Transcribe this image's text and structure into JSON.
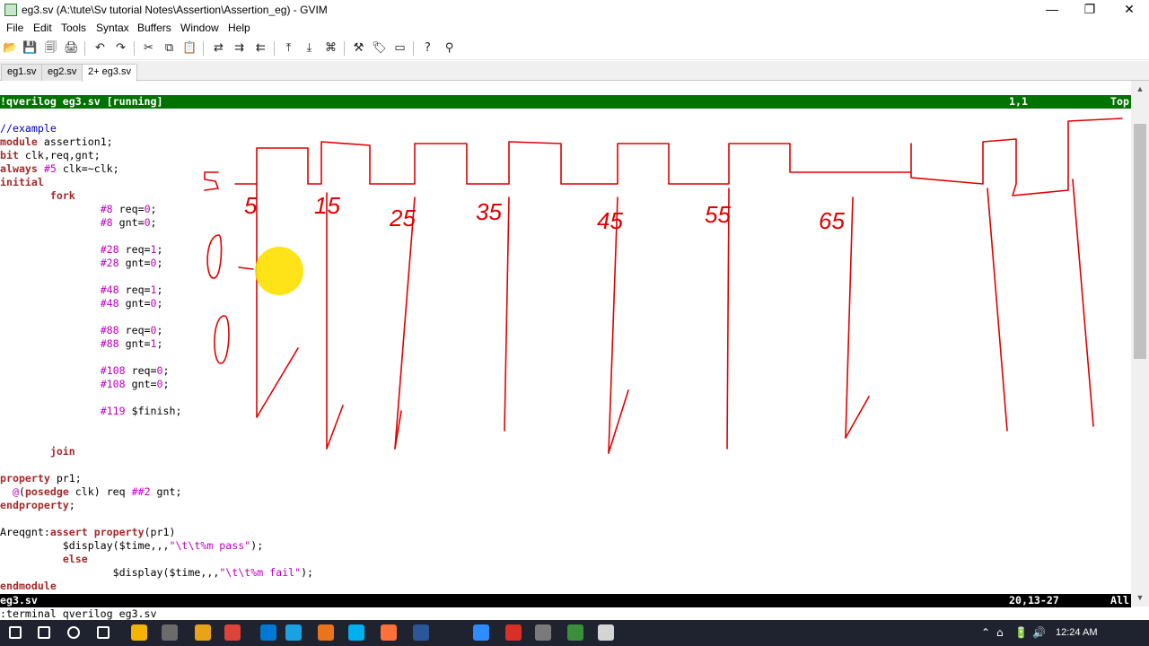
{
  "window": {
    "title": "eg3.sv (A:\\tute\\Sv tutorial Notes\\Assertion\\Assertion_eg) - GVIM",
    "minimize_glyph": "—",
    "maximize_glyph": "❐",
    "close_glyph": "✕"
  },
  "menu": [
    "File",
    "Edit",
    "Tools",
    "Syntax",
    "Buffers",
    "Window",
    "Help"
  ],
  "toolbar_icons": [
    "open-icon",
    "save-icon",
    "save-all-icon",
    "print-icon",
    "undo-icon",
    "redo-icon",
    "cut-icon",
    "copy-icon",
    "paste-icon",
    "replace-icon",
    "find-next-icon",
    "find-prev-icon",
    "load-session-icon",
    "save-session-icon",
    "run-script-icon",
    "make-icon",
    "build-tags-icon",
    "jump-tag-icon",
    "help-icon",
    "find-help-icon"
  ],
  "toolbar_glyphs": [
    "📂",
    "💾",
    "🗐",
    "🖨",
    "↶",
    "↷",
    "✂",
    "⧉",
    "📋",
    "⇄",
    "⇉",
    "⇇",
    "⤒",
    "⤓",
    "⌘",
    "⚒",
    "🏷",
    "▭",
    "?",
    "⚲"
  ],
  "tabs": [
    {
      "label": "eg1.sv",
      "active": false
    },
    {
      "label": "eg2.sv",
      "active": false
    },
    {
      "label": "2+ eg3.sv",
      "active": true
    }
  ],
  "top_status": {
    "left": "!qverilog eg3.sv [running]",
    "position": "1,1",
    "percent": "Top"
  },
  "bottom_status": {
    "left": "eg3.sv",
    "position": "20,13-27",
    "percent": "All"
  },
  "code_lines": [
    [
      {
        "t": "//example",
        "c": "cm"
      }
    ],
    [
      {
        "t": "module",
        "c": "kw"
      },
      {
        "t": " assertion1;"
      }
    ],
    [
      {
        "t": "bit",
        "c": "kw"
      },
      {
        "t": " clk,req,gnt;"
      }
    ],
    [
      {
        "t": "always",
        "c": "kw"
      },
      {
        "t": " "
      },
      {
        "t": "#5",
        "c": "num"
      },
      {
        "t": " clk=~clk;"
      }
    ],
    [
      {
        "t": "initial",
        "c": "kw"
      }
    ],
    [
      {
        "t": "        "
      },
      {
        "t": "fork",
        "c": "kw"
      }
    ],
    [
      {
        "t": "                "
      },
      {
        "t": "#8",
        "c": "num"
      },
      {
        "t": " req="
      },
      {
        "t": "0",
        "c": "num"
      },
      {
        "t": ";"
      }
    ],
    [
      {
        "t": "                "
      },
      {
        "t": "#8",
        "c": "num"
      },
      {
        "t": " gnt="
      },
      {
        "t": "0",
        "c": "num"
      },
      {
        "t": ";"
      }
    ],
    [
      {
        "t": ""
      }
    ],
    [
      {
        "t": "                "
      },
      {
        "t": "#28",
        "c": "num"
      },
      {
        "t": " req="
      },
      {
        "t": "1",
        "c": "num"
      },
      {
        "t": ";"
      }
    ],
    [
      {
        "t": "                "
      },
      {
        "t": "#28",
        "c": "num"
      },
      {
        "t": " gnt="
      },
      {
        "t": "0",
        "c": "num"
      },
      {
        "t": ";"
      }
    ],
    [
      {
        "t": ""
      }
    ],
    [
      {
        "t": "                "
      },
      {
        "t": "#48",
        "c": "num"
      },
      {
        "t": " req="
      },
      {
        "t": "1",
        "c": "num"
      },
      {
        "t": ";"
      }
    ],
    [
      {
        "t": "                "
      },
      {
        "t": "#48",
        "c": "num"
      },
      {
        "t": " gnt="
      },
      {
        "t": "0",
        "c": "num"
      },
      {
        "t": ";"
      }
    ],
    [
      {
        "t": ""
      }
    ],
    [
      {
        "t": "                "
      },
      {
        "t": "#88",
        "c": "num"
      },
      {
        "t": " req="
      },
      {
        "t": "0",
        "c": "num"
      },
      {
        "t": ";"
      }
    ],
    [
      {
        "t": "                "
      },
      {
        "t": "#88",
        "c": "num"
      },
      {
        "t": " gnt="
      },
      {
        "t": "1",
        "c": "num"
      },
      {
        "t": ";"
      }
    ],
    [
      {
        "t": ""
      }
    ],
    [
      {
        "t": "                "
      },
      {
        "t": "#108",
        "c": "num"
      },
      {
        "t": " req="
      },
      {
        "t": "0",
        "c": "num"
      },
      {
        "t": ";"
      }
    ],
    [
      {
        "t": "                "
      },
      {
        "t": "#108",
        "c": "num"
      },
      {
        "t": " gnt="
      },
      {
        "t": "0",
        "c": "num"
      },
      {
        "t": ";"
      }
    ],
    [
      {
        "t": ""
      }
    ],
    [
      {
        "t": "                "
      },
      {
        "t": "#119",
        "c": "num"
      },
      {
        "t": " $finish;"
      }
    ],
    [
      {
        "t": ""
      }
    ],
    [
      {
        "t": ""
      }
    ],
    [
      {
        "t": "        "
      },
      {
        "t": "join",
        "c": "kw"
      }
    ],
    [
      {
        "t": ""
      }
    ],
    [
      {
        "t": "property",
        "c": "kw"
      },
      {
        "t": " pr1;"
      }
    ],
    [
      {
        "t": "  "
      },
      {
        "t": "@",
        "c": "num"
      },
      {
        "t": "("
      },
      {
        "t": "posedge",
        "c": "kw"
      },
      {
        "t": " clk) req "
      },
      {
        "t": "##2",
        "c": "num"
      },
      {
        "t": " gnt;"
      }
    ],
    [
      {
        "t": "endproperty",
        "c": "kw"
      },
      {
        "t": ";"
      }
    ],
    [
      {
        "t": ""
      }
    ],
    [
      {
        "t": "Areqgnt:"
      },
      {
        "t": "assert",
        "c": "kw"
      },
      {
        "t": " "
      },
      {
        "t": "property",
        "c": "kw"
      },
      {
        "t": "(pr1)"
      }
    ],
    [
      {
        "t": "          $display($time,,,"
      },
      {
        "t": "\"\\t\\t%m pass\"",
        "c": "str"
      },
      {
        "t": ");"
      }
    ],
    [
      {
        "t": "          "
      },
      {
        "t": "else",
        "c": "kw"
      }
    ],
    [
      {
        "t": "                  $display($time,,,"
      },
      {
        "t": "\"\\t\\t%m fail\"",
        "c": "str"
      },
      {
        "t": ");"
      }
    ],
    [
      {
        "t": "endmodule",
        "c": "kw"
      }
    ]
  ],
  "command_line": ":terminal qverilog eg3.sv",
  "handwritten_labels": [
    "5",
    "5",
    "15",
    "25",
    "35",
    "45",
    "55",
    "65"
  ],
  "ink_color": "#e00000",
  "highlight_color": "#ffe000",
  "taskbar_icons": [
    "windows-start-icon",
    "search-icon",
    "task-view-icon",
    "task-manager-icon",
    "file-explorer-icon",
    "camera-icon",
    "chrome-icon",
    "folder-icon",
    "mail-icon",
    "edge-icon",
    "app-orange-icon",
    "skype-icon",
    "firefox-icon",
    "word-icon",
    "zoom-icon",
    "recorder-icon",
    "settings-icon",
    "gvim-icon",
    "paint-icon"
  ],
  "tray_glyphs": [
    "⌃",
    "⌂",
    "🔋",
    "🔊",
    "⌨"
  ],
  "clock": "12:24 AM"
}
